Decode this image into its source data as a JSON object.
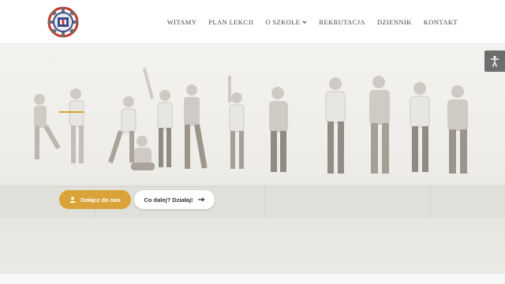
{
  "header": {
    "logo_icon": "school-emblem-icon",
    "nav": [
      {
        "label": "WITAMY",
        "has_dropdown": false
      },
      {
        "label": "PLAN LEKCJI",
        "has_dropdown": false
      },
      {
        "label": "O SZKOLE",
        "has_dropdown": true
      },
      {
        "label": "REKRUTACJA",
        "has_dropdown": false
      },
      {
        "label": "DZIENNIK",
        "has_dropdown": false
      },
      {
        "label": "KONTAKT",
        "has_dropdown": false
      }
    ]
  },
  "hero": {
    "join_button": {
      "label": "Dołącz do nas",
      "icon": "user-icon"
    },
    "next_button": {
      "label": "Co dalej? Działaj!",
      "icon": "arrow-right-icon"
    },
    "accent_color": "#d9a33a"
  },
  "accessibility": {
    "icon": "accessibility-icon"
  }
}
